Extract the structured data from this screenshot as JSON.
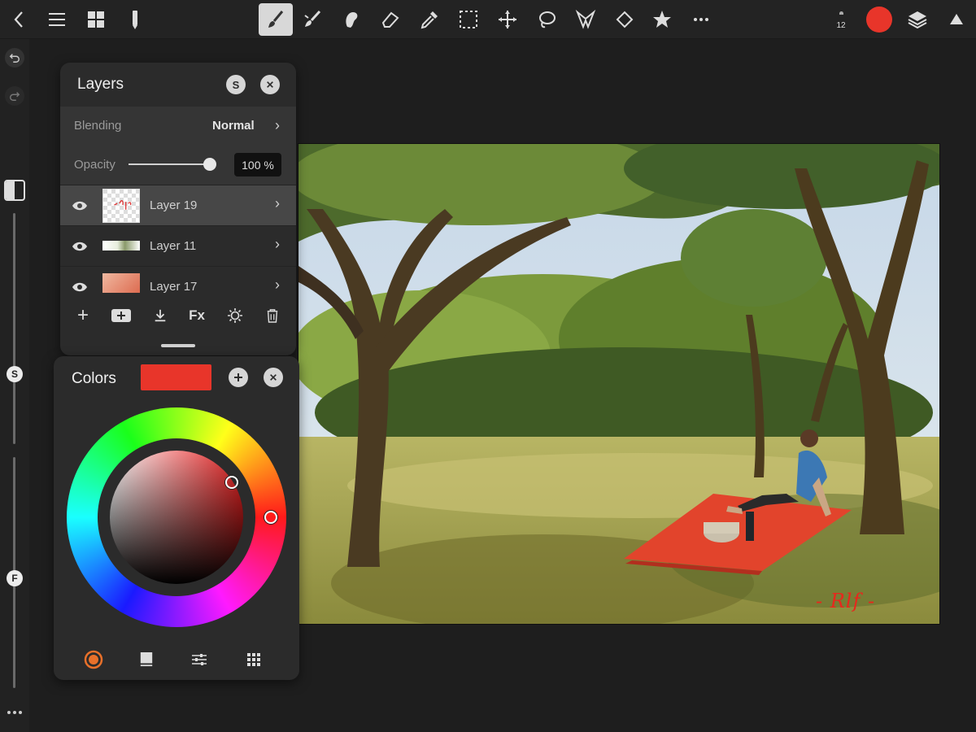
{
  "toolbar": {
    "brush_size": "12",
    "current_color": "#e8352a"
  },
  "layers_panel": {
    "title": "Layers",
    "s_button": "S",
    "blending_label": "Blending",
    "blending_value": "Normal",
    "opacity_label": "Opacity",
    "opacity_value": "100 %",
    "opacity_fraction": 1.0,
    "layers": [
      {
        "name": "Layer 19"
      },
      {
        "name": "Layer 11"
      },
      {
        "name": "Layer 17"
      }
    ],
    "fx_label": "Fx"
  },
  "colors_panel": {
    "title": "Colors",
    "swatch": "#e8352a"
  },
  "sidebar": {
    "size_knob": "S",
    "flow_knob": "F"
  },
  "canvas": {
    "signature": "- Rlf -"
  }
}
